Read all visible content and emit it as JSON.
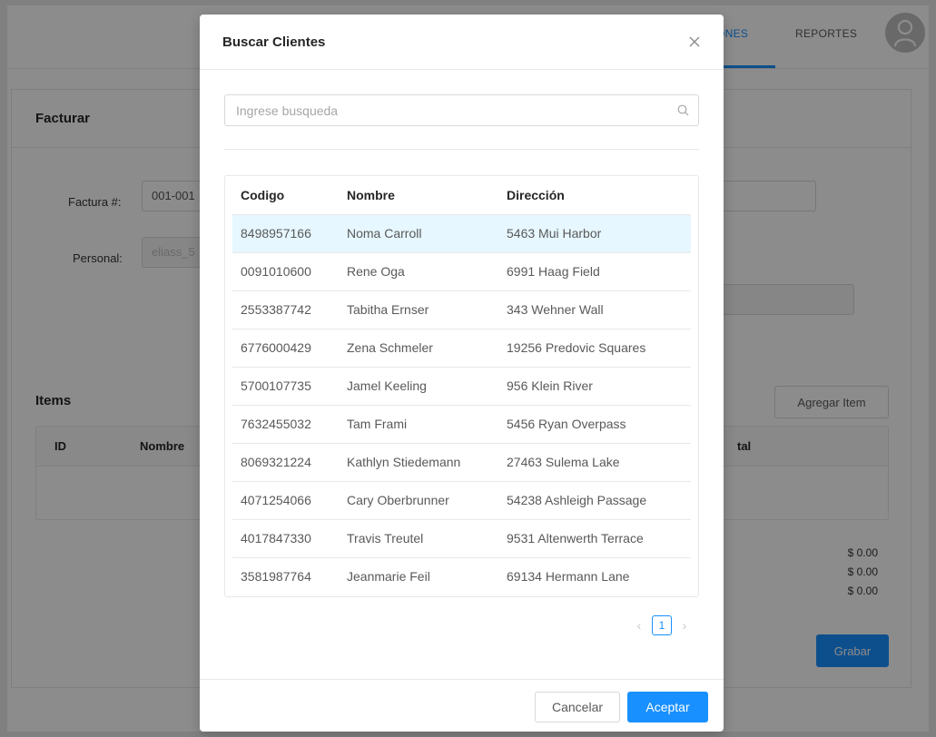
{
  "background": {
    "nav": {
      "tab_partial": "ONES",
      "tab_reportes": "REPORTES"
    },
    "card_title": "Facturar",
    "factura_label": "Factura #:",
    "factura_value": "001-001",
    "personal_label": "Personal:",
    "personal_value": "eliass_5",
    "items_title": "Items",
    "add_item_label": "Agregar Item",
    "items_columns": {
      "id": "ID",
      "nombre": "Nombre",
      "total_partial": "tal"
    },
    "totals": [
      "$ 0.00",
      "$ 0.00",
      "$ 0.00"
    ],
    "grabar_label": "Grabar"
  },
  "modal": {
    "title": "Buscar Clientes",
    "search_placeholder": "Ingrese busqueda",
    "columns": {
      "codigo": "Codigo",
      "nombre": "Nombre",
      "direccion": "Dirección"
    },
    "rows": [
      {
        "codigo": "8498957166",
        "nombre": "Noma Carroll",
        "direccion": "5463 Mui Harbor",
        "selected": true
      },
      {
        "codigo": "0091010600",
        "nombre": "Rene Oga",
        "direccion": "6991 Haag Field"
      },
      {
        "codigo": "2553387742",
        "nombre": "Tabitha Ernser",
        "direccion": "343 Wehner Wall"
      },
      {
        "codigo": "6776000429",
        "nombre": "Zena Schmeler",
        "direccion": "19256 Predovic Squares"
      },
      {
        "codigo": "5700107735",
        "nombre": "Jamel Keeling",
        "direccion": "956 Klein River"
      },
      {
        "codigo": "7632455032",
        "nombre": "Tam Frami",
        "direccion": "5456 Ryan Overpass"
      },
      {
        "codigo": "8069321224",
        "nombre": "Kathlyn Stiedemann",
        "direccion": "27463 Sulema Lake"
      },
      {
        "codigo": "4071254066",
        "nombre": "Cary Oberbrunner",
        "direccion": "54238 Ashleigh Passage"
      },
      {
        "codigo": "4017847330",
        "nombre": "Travis Treutel",
        "direccion": "9531 Altenwerth Terrace"
      },
      {
        "codigo": "3581987764",
        "nombre": "Jeanmarie Feil",
        "direccion": "69134 Hermann Lane"
      }
    ],
    "pagination": {
      "current": "1"
    },
    "cancel_label": "Cancelar",
    "ok_label": "Aceptar"
  },
  "colors": {
    "primary": "#1890ff",
    "selected_row": "#e6f7ff"
  }
}
